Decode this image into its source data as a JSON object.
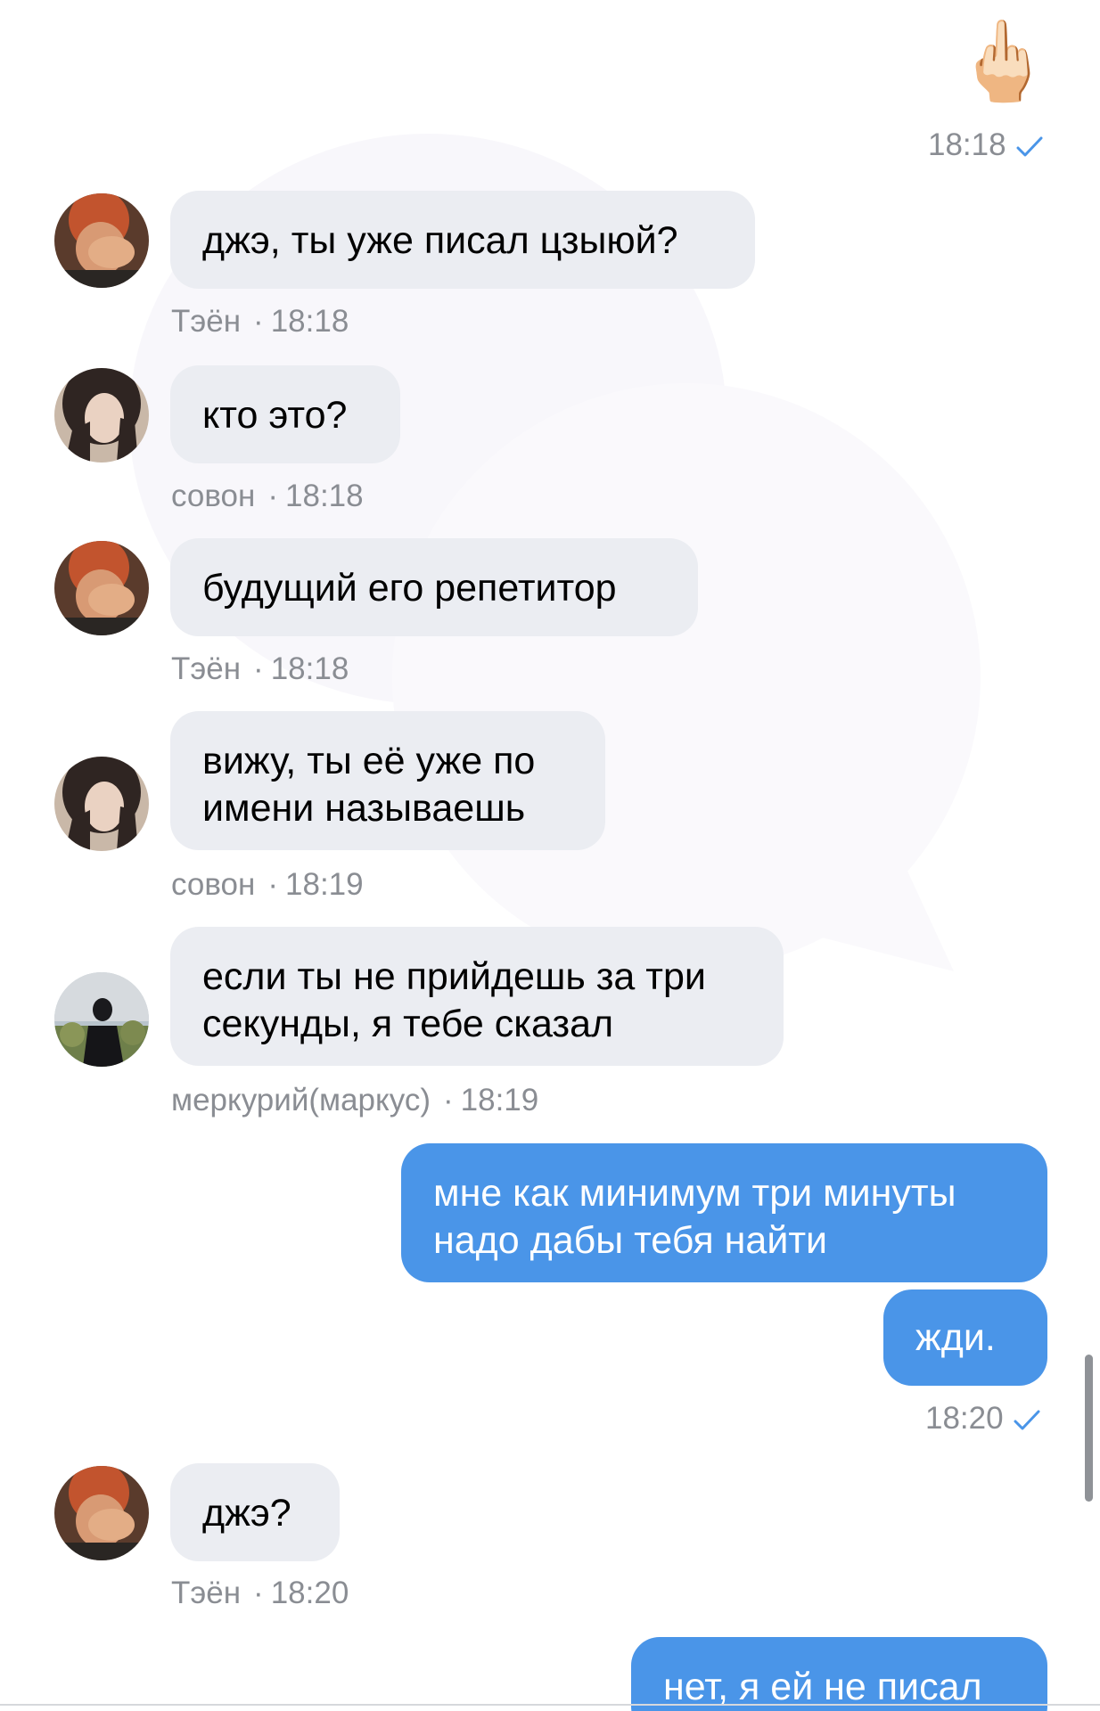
{
  "sticker": {
    "emoji": "🖕🏻"
  },
  "messages": [
    {
      "type": "outgoing-time",
      "time": "18:18"
    },
    {
      "type": "in",
      "sender": "Тэён",
      "time": "18:18",
      "text": [
        "джэ, ты уже писал цзыюй?"
      ]
    },
    {
      "type": "in",
      "sender": "совон",
      "time": "18:18",
      "text": [
        "кто это?"
      ]
    },
    {
      "type": "in",
      "sender": "Тэён",
      "time": "18:18",
      "text": [
        "будущий его репетитор"
      ]
    },
    {
      "type": "in",
      "sender": "совон",
      "time": "18:19",
      "text": [
        "вижу, ты её уже по",
        "имени называешь"
      ]
    },
    {
      "type": "in",
      "sender": "меркурий(маркус)",
      "time": "18:19",
      "text": [
        "если ты не прийдешь за три",
        "секунды, я тебе сказал"
      ]
    },
    {
      "type": "out",
      "text": [
        "мне как минимум три минуты",
        "надо дабы тебя найти"
      ]
    },
    {
      "type": "out",
      "text": [
        "жди."
      ],
      "time": "18:20"
    },
    {
      "type": "in",
      "sender": "Тэён",
      "time": "18:20",
      "text": [
        "джэ?"
      ]
    },
    {
      "type": "out",
      "text": [
        "нет, я ей не писал"
      ]
    }
  ],
  "colors": {
    "incoming_bubble": "#ebedf2",
    "outgoing_bubble": "#4a95e8",
    "meta_text": "#8a8d93",
    "read_check": "#4a95e8"
  },
  "icons": {
    "read": "check-icon"
  }
}
